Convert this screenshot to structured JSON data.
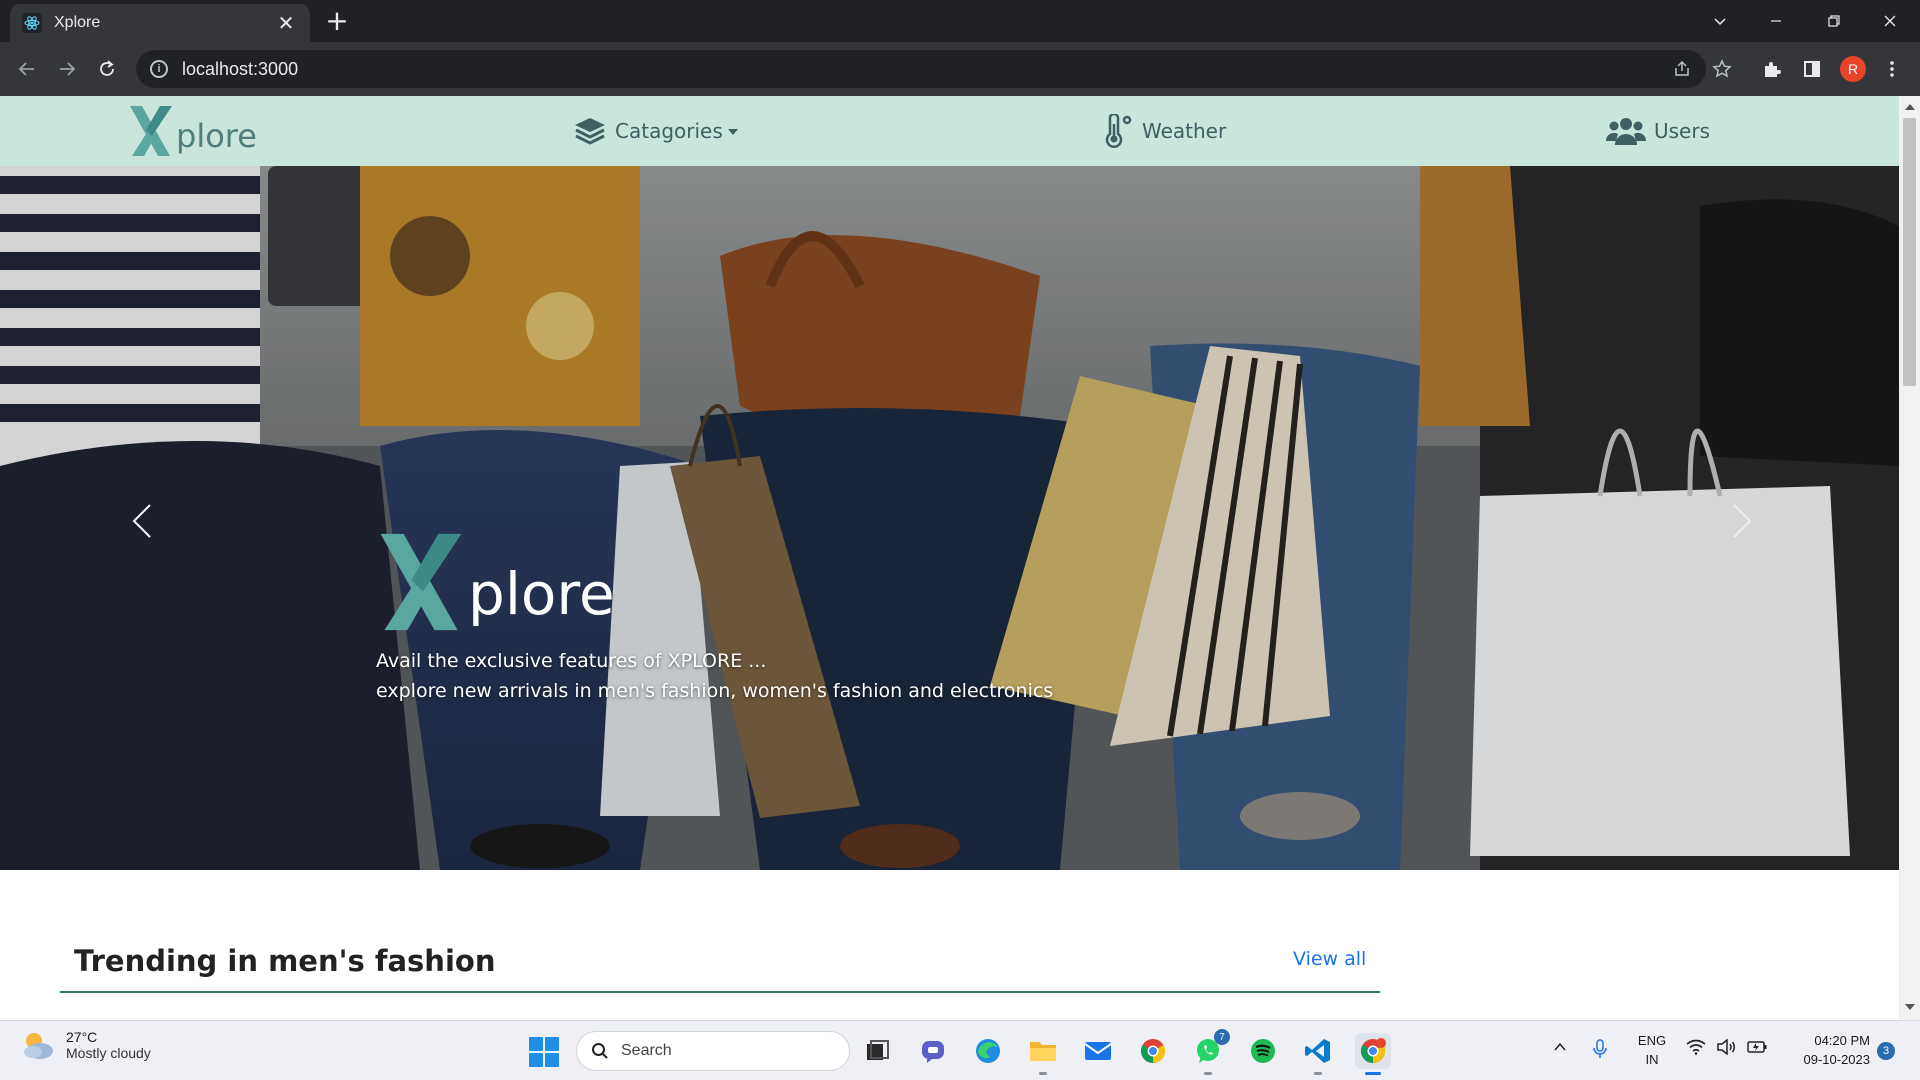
{
  "browser": {
    "tab_title": "Xplore",
    "tab_close": "✕",
    "new_tab": "+",
    "url": "localhost:3000",
    "profile_initial": "R"
  },
  "site": {
    "brand": "plore",
    "nav": {
      "categories": "Catagories",
      "weather": "Weather",
      "users": "Users"
    },
    "hero": {
      "logo_text": "plore",
      "caption_line1": "Avail the exclusive features of XPLORE ...",
      "caption_line2": "explore new arrivals in men's fashion, women's fashion and electronics"
    },
    "section": {
      "title": "Trending in men's fashion",
      "view_all": "View all"
    }
  },
  "taskbar": {
    "weather_temp": "27°C",
    "weather_desc": "Mostly cloudy",
    "search_label": "Search",
    "whatsapp_badge": "7",
    "lang_line1": "ENG",
    "lang_line2": "IN",
    "time": "04:20 PM",
    "date": "09-10-2023",
    "notification_count": "3",
    "apps": [
      "task-view",
      "teams-chat",
      "edge",
      "file-explorer",
      "mail",
      "chrome",
      "whatsapp",
      "spotify",
      "vscode",
      "chrome-profile"
    ]
  },
  "colors": {
    "nav_bg": "#c9e5dc",
    "brand_teal": "#5aa7a0",
    "link_blue": "#1a73e8",
    "section_rule": "#2f7d6e"
  }
}
